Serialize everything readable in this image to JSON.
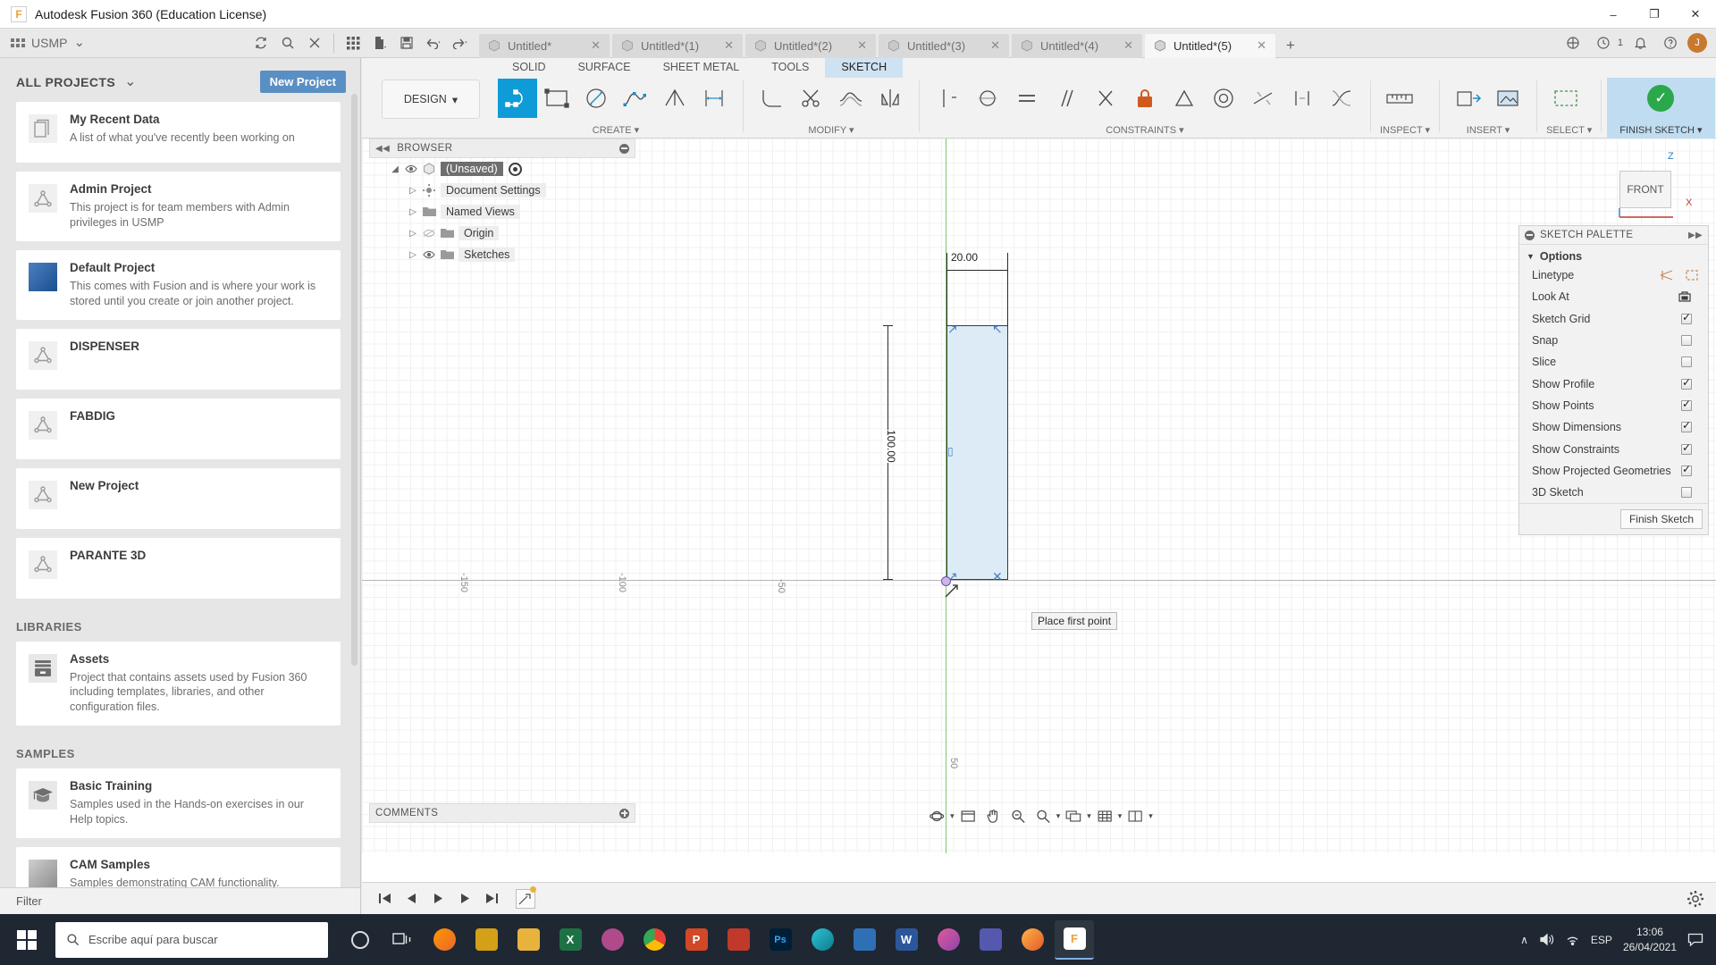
{
  "window": {
    "title": "Autodesk Fusion 360 (Education License)",
    "logo_letter": "F",
    "minimize": "–",
    "maximize": "❐",
    "close": "✕"
  },
  "appbar": {
    "team": "USMP",
    "team_chevron": "⌄",
    "icons": [
      "grid-icon",
      "refresh-icon",
      "search-icon",
      "close-icon",
      "new-file-icon",
      "save-icon",
      "undo-icon",
      "redo-icon"
    ],
    "tabs": [
      {
        "label": "Untitled*",
        "close": "✕",
        "active": false
      },
      {
        "label": "Untitled*(1)",
        "close": "✕",
        "active": false
      },
      {
        "label": "Untitled*(2)",
        "close": "✕",
        "active": false
      },
      {
        "label": "Untitled*(3)",
        "close": "✕",
        "active": false
      },
      {
        "label": "Untitled*(4)",
        "close": "✕",
        "active": false
      },
      {
        "label": "Untitled*(5)",
        "close": "✕",
        "active": true
      }
    ],
    "add_tab": "+",
    "notification_count": "1",
    "avatar_initial": "J"
  },
  "datapanel": {
    "header": "ALL PROJECTS",
    "header_chevron": "⌄",
    "new_project_label": "New Project",
    "projects": [
      {
        "name": "My Recent Data",
        "desc": "A list of what you've recently been working on",
        "icon": "documents-icon"
      },
      {
        "name": "Admin Project",
        "desc": "This project is for team members with Admin privileges in USMP",
        "icon": "project-icon"
      },
      {
        "name": "Default Project",
        "desc": "This comes with Fusion and is where your work is stored until you create or join another project.",
        "icon": "fusion-thumb-icon"
      },
      {
        "name": "DISPENSER",
        "desc": "",
        "icon": "project-icon"
      },
      {
        "name": "FABDIG",
        "desc": "",
        "icon": "project-icon"
      },
      {
        "name": "New Project",
        "desc": "",
        "icon": "project-icon"
      },
      {
        "name": "PARANTE 3D",
        "desc": "",
        "icon": "project-icon"
      }
    ],
    "libraries_label": "LIBRARIES",
    "libraries": [
      {
        "name": "Assets",
        "desc": "Project that contains assets used by Fusion 360 including templates, libraries, and other configuration files.",
        "icon": "archive-icon"
      }
    ],
    "samples_label": "SAMPLES",
    "samples": [
      {
        "name": "Basic Training",
        "desc": "Samples used in the Hands-on exercises in our Help topics.",
        "icon": "graduation-cap-icon"
      },
      {
        "name": "CAM Samples",
        "desc": "Samples demonstrating CAM functionality.",
        "link": "http://autode.sk/f360cam",
        "icon": "cam-thumb-icon"
      }
    ],
    "filter_label": "Filter"
  },
  "ribbon": {
    "design_label": "DESIGN",
    "design_chevron": "▾",
    "tabs": [
      {
        "label": "SOLID",
        "active": false
      },
      {
        "label": "SURFACE",
        "active": false
      },
      {
        "label": "SHEET METAL",
        "active": false
      },
      {
        "label": "TOOLS",
        "active": false
      },
      {
        "label": "SKETCH",
        "active": true
      }
    ],
    "groups": [
      {
        "label": "CREATE ▾",
        "tools": [
          "line-tool-icon",
          "rectangle-tool-icon",
          "circle-tool-icon",
          "spline-tool-icon",
          "arc-tool-icon",
          "dimension-tool-icon"
        ]
      },
      {
        "label": "MODIFY ▾",
        "tools": [
          "fillet-icon",
          "trim-icon",
          "offset-icon",
          "mirror-icon"
        ]
      },
      {
        "label": "CONSTRAINTS ▾",
        "tools": [
          "vertical-constraint-icon",
          "tangent-constraint-icon",
          "equal-constraint-icon",
          "parallel-constraint-icon",
          "perpendicular-constraint-icon",
          "fix-lock-icon",
          "midpoint-icon",
          "concentric-icon",
          "collinear-icon",
          "symmetry-icon",
          "curvature-icon"
        ]
      },
      {
        "label": "INSPECT ▾",
        "tools": [
          "measure-icon"
        ]
      },
      {
        "label": "INSERT ▾",
        "tools": [
          "insert-derive-icon",
          "insert-canvas-icon"
        ]
      },
      {
        "label": "SELECT ▾",
        "tools": [
          "select-window-icon"
        ]
      },
      {
        "label": "FINISH SKETCH ▾",
        "tools": [
          "finish-sketch-check-icon"
        ]
      }
    ]
  },
  "browser": {
    "title": "BROWSER",
    "collapse_icon": "◀◀",
    "nodes": [
      {
        "label": "(Unsaved)",
        "root": true,
        "eye": true,
        "arrow": "◢"
      },
      {
        "label": "Document Settings",
        "arrow": "▷",
        "icon": "gear-icon"
      },
      {
        "label": "Named Views",
        "arrow": "▷",
        "icon": "folder-icon"
      },
      {
        "label": "Origin",
        "arrow": "▷",
        "icon": "folder-icon",
        "hidden_eye": true
      },
      {
        "label": "Sketches",
        "arrow": "▷",
        "icon": "folder-icon",
        "eye": true
      }
    ]
  },
  "canvas": {
    "dimension_top": "20.00",
    "dimension_left": "100.00",
    "tooltip": "Place first point",
    "ruler_labels": [
      "-150",
      "-100",
      "-50",
      "50"
    ],
    "viewcube_face": "FRONT",
    "viewcube_axis_z": "Z",
    "viewcube_axis_x": "X"
  },
  "palette": {
    "title": "SKETCH PALETTE",
    "expand_icon": "▶▶",
    "section": "Options",
    "section_arrow": "▼",
    "rows": [
      {
        "label": "Linetype",
        "type": "icons",
        "icons": [
          "construction-line-icon",
          "centerline-icon"
        ]
      },
      {
        "label": "Look At",
        "type": "icon",
        "icons": [
          "look-at-icon"
        ]
      },
      {
        "label": "Sketch Grid",
        "type": "checkbox",
        "checked": true
      },
      {
        "label": "Snap",
        "type": "checkbox",
        "checked": false
      },
      {
        "label": "Slice",
        "type": "checkbox",
        "checked": false
      },
      {
        "label": "Show Profile",
        "type": "checkbox",
        "checked": true
      },
      {
        "label": "Show Points",
        "type": "checkbox",
        "checked": true
      },
      {
        "label": "Show Dimensions",
        "type": "checkbox",
        "checked": true
      },
      {
        "label": "Show Constraints",
        "type": "checkbox",
        "checked": true
      },
      {
        "label": "Show Projected Geometries",
        "type": "checkbox",
        "checked": true
      },
      {
        "label": "3D Sketch",
        "type": "checkbox",
        "checked": false
      }
    ],
    "finish_button": "Finish Sketch"
  },
  "comments": {
    "title": "COMMENTS"
  },
  "navbar": {
    "items": [
      "orbit-icon",
      "pan-display-icon",
      "pan-icon",
      "zoom-icon",
      "zoom-window-icon",
      "display-settings-icon",
      "grid-settings-icon",
      "viewports-icon"
    ]
  },
  "timeline": {
    "controls": [
      "skip-start-icon",
      "step-back-icon",
      "play-icon",
      "step-forward-icon",
      "skip-end-icon"
    ],
    "marker": "sketch-timeline-marker",
    "settings": "gear-icon"
  },
  "taskbar": {
    "start": "windows-start-icon",
    "search_placeholder": "Escribe aquí para buscar",
    "search_icon": "search-icon",
    "apps": [
      {
        "name": "cortana-icon",
        "label": "○",
        "color": "#2b3a4a"
      },
      {
        "name": "task-view-icon",
        "label": "⧉",
        "color": "#2b3a4a"
      },
      {
        "name": "firefox-icon",
        "label": "◉",
        "color": "#e8682c"
      },
      {
        "name": "store-icon",
        "label": "▦",
        "color": "#d4a017"
      },
      {
        "name": "file-explorer-icon",
        "label": "▰",
        "color": "#e8b33d"
      },
      {
        "name": "excel-icon",
        "label": "X",
        "color": "#1e7145"
      },
      {
        "name": "mesh-icon",
        "label": "◈",
        "color": "#b04a8a"
      },
      {
        "name": "chrome-icon",
        "label": "◯",
        "color": "#4285f4"
      },
      {
        "name": "powerpoint-icon",
        "label": "P",
        "color": "#d24726"
      },
      {
        "name": "sketchup-icon",
        "label": "▲",
        "color": "#c0392b"
      },
      {
        "name": "photoshop-icon",
        "label": "Ps",
        "color": "#001e36"
      },
      {
        "name": "edge-icon",
        "label": "◔",
        "color": "#0d7c8a"
      },
      {
        "name": "media-icon",
        "label": "▶",
        "color": "#2f6fb5"
      },
      {
        "name": "word-icon",
        "label": "W",
        "color": "#2b579a"
      },
      {
        "name": "paint-icon",
        "label": "◑",
        "color": "#8e44ad"
      },
      {
        "name": "teams-icon",
        "label": "▣",
        "color": "#5558af"
      },
      {
        "name": "browser2-icon",
        "label": "●",
        "color": "#e05a2b"
      },
      {
        "name": "fusion-icon",
        "label": "F",
        "color": "#e8a33d"
      }
    ],
    "tray": {
      "chevron": "∧",
      "volume": "volume-icon",
      "wifi": "wifi-icon",
      "language": "ESP"
    },
    "clock_time": "13:06",
    "clock_date": "26/04/2021",
    "action_center": "notification-icon"
  },
  "colors": {
    "accent_blue": "#1e8bc8",
    "new_project_blue": "#5a8fc4",
    "active_tab_bg": "#cfe2f2",
    "finish_green": "#2aa84a",
    "taskbar_bg": "#1f2733",
    "profile_fill": "#ddebf7"
  }
}
